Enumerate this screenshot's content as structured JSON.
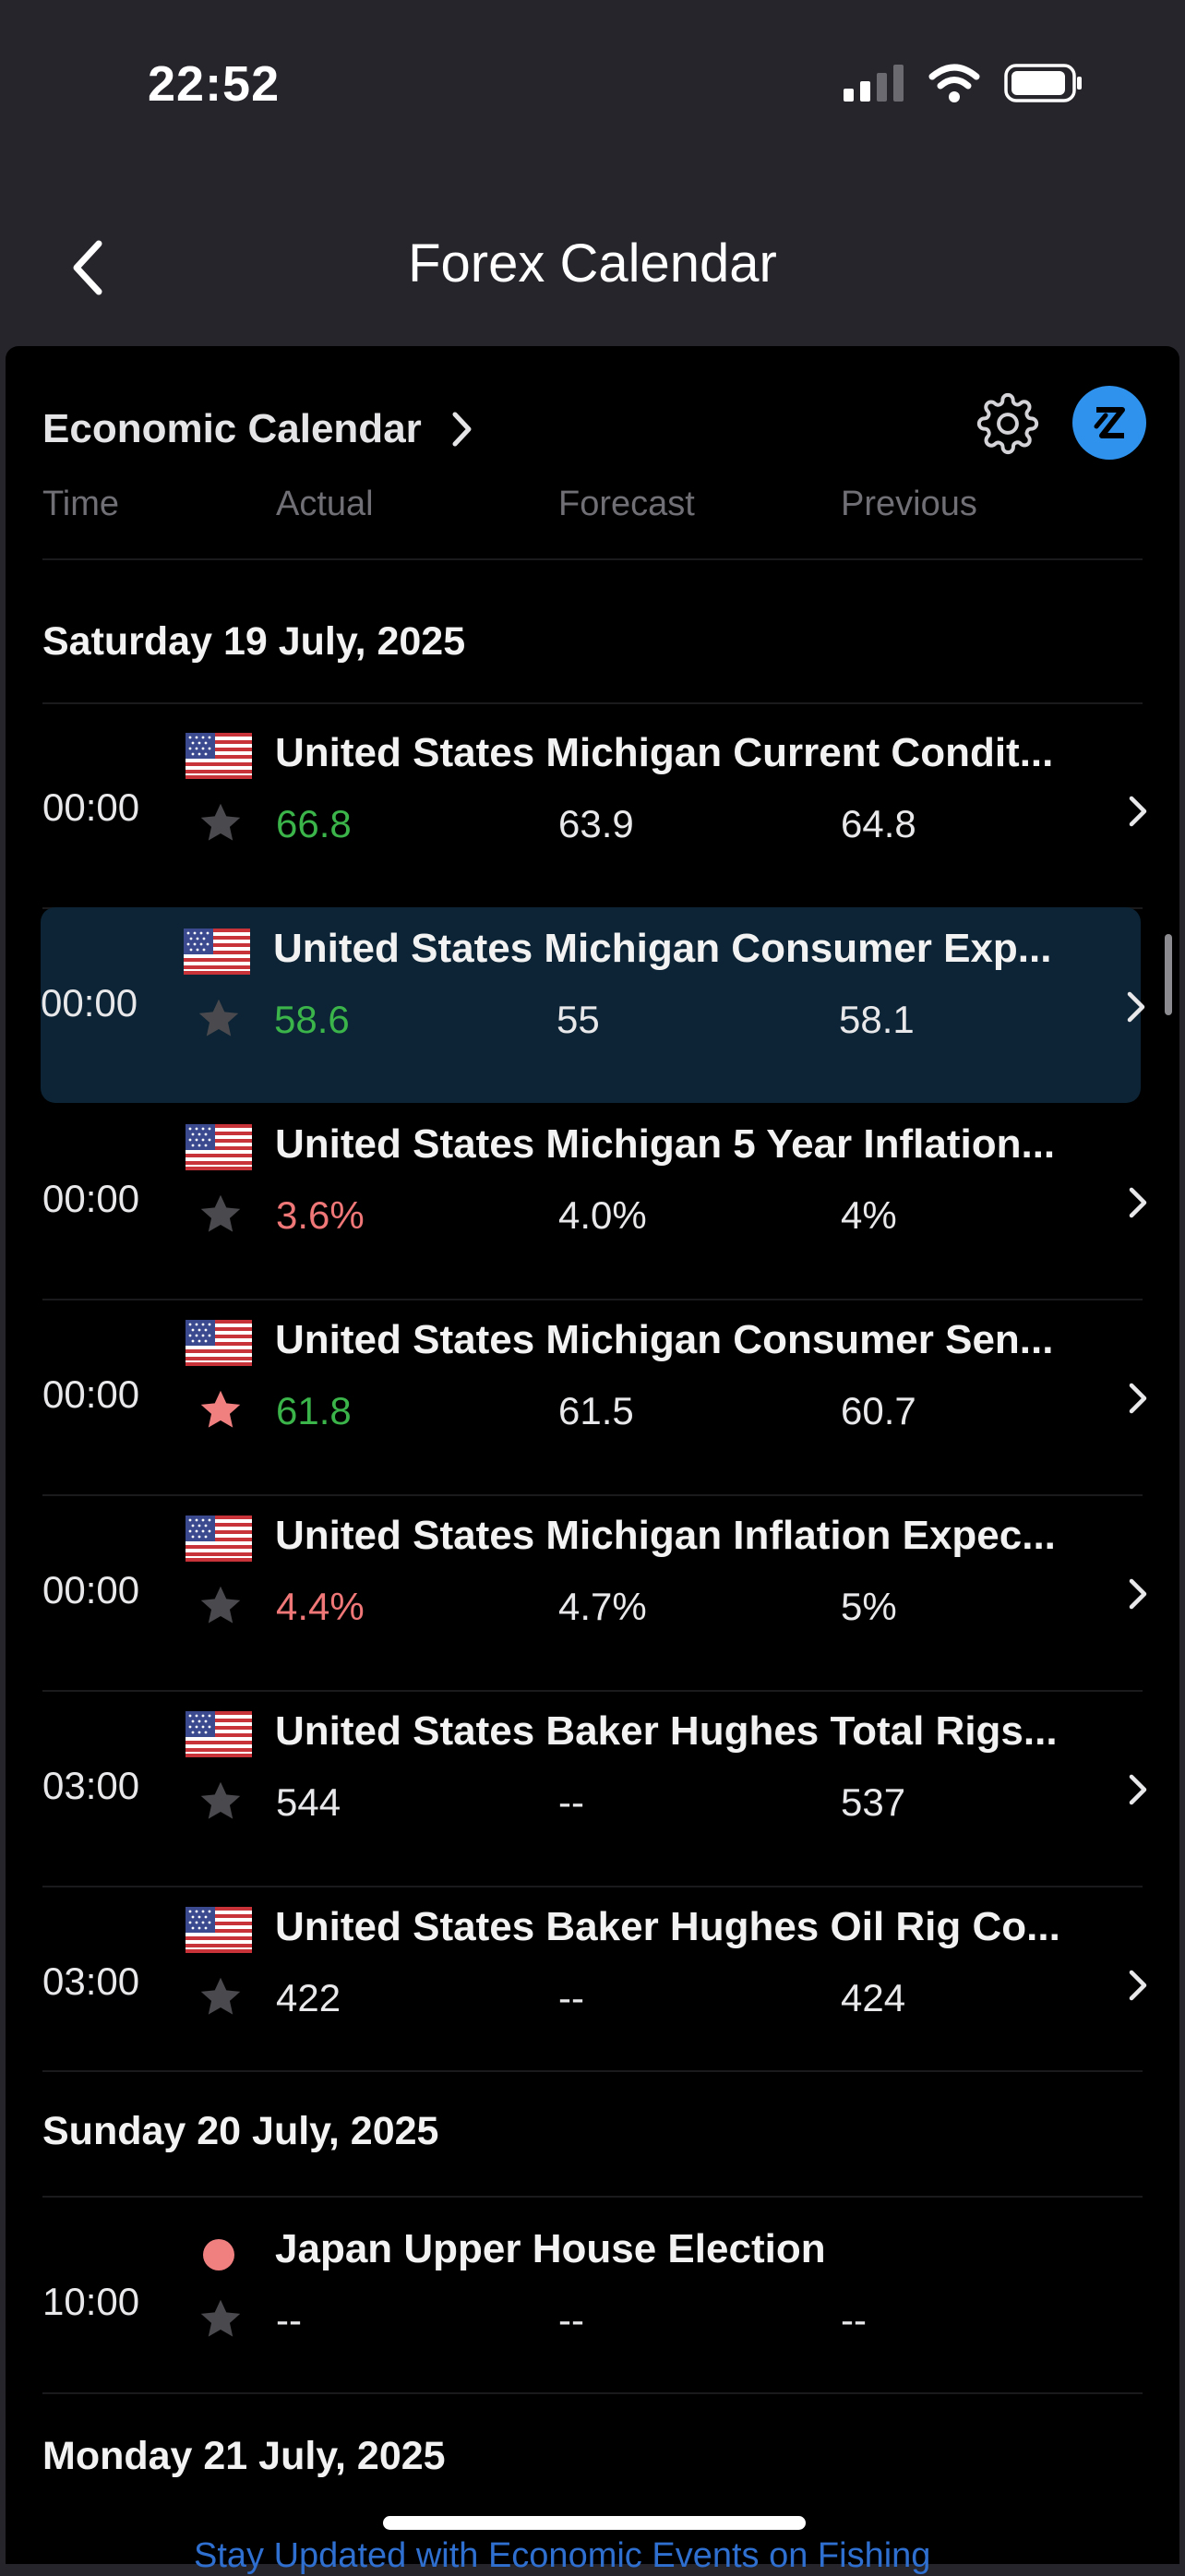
{
  "status_bar": {
    "time": "22:52"
  },
  "nav": {
    "title": "Forex Calendar"
  },
  "panel": {
    "title": "Economic Calendar",
    "columns": {
      "time": "Time",
      "actual": "Actual",
      "forecast": "Forecast",
      "previous": "Previous"
    }
  },
  "days": [
    {
      "label": "Saturday 19 July, 2025"
    },
    {
      "label": "Sunday 20 July, 2025"
    },
    {
      "label": "Monday 21 July, 2025"
    }
  ],
  "events": [
    {
      "time": "00:00",
      "name": "United States Michigan Current Condit...",
      "actual": "66.8",
      "forecast": "63.9",
      "previous": "64.8",
      "actual_trend": "up",
      "starred": false,
      "marker": "us-flag"
    },
    {
      "time": "00:00",
      "name": "United States Michigan Consumer Exp...",
      "actual": "58.6",
      "forecast": "55",
      "previous": "58.1",
      "actual_trend": "up",
      "starred": false,
      "marker": "us-flag",
      "highlighted": true
    },
    {
      "time": "00:00",
      "name": "United States Michigan 5 Year Inflation...",
      "actual": "3.6%",
      "forecast": "4.0%",
      "previous": "4%",
      "actual_trend": "down",
      "starred": false,
      "marker": "us-flag"
    },
    {
      "time": "00:00",
      "name": "United States Michigan Consumer Sen...",
      "actual": "61.8",
      "forecast": "61.5",
      "previous": "60.7",
      "actual_trend": "up",
      "starred": true,
      "marker": "us-flag"
    },
    {
      "time": "00:00",
      "name": "United States Michigan Inflation Expec...",
      "actual": "4.4%",
      "forecast": "4.7%",
      "previous": "5%",
      "actual_trend": "down",
      "starred": false,
      "marker": "us-flag"
    },
    {
      "time": "03:00",
      "name": "United States Baker Hughes Total Rigs...",
      "actual": "544",
      "forecast": "--",
      "previous": "537",
      "actual_trend": "neutral",
      "starred": false,
      "marker": "us-flag"
    },
    {
      "time": "03:00",
      "name": "United States Baker Hughes Oil Rig Co...",
      "actual": "422",
      "forecast": "--",
      "previous": "424",
      "actual_trend": "neutral",
      "starred": false,
      "marker": "us-flag"
    },
    {
      "time": "10:00",
      "name": "Japan Upper House Election",
      "actual": "--",
      "forecast": "--",
      "previous": "--",
      "actual_trend": "neutral",
      "starred": false,
      "marker": "japan-dot"
    }
  ],
  "promo": {
    "text": "Stay Updated with Economic Events on Fishing"
  },
  "colors": {
    "background": "#26252b",
    "panel": "#000000",
    "highlight_row": "#0c2435",
    "positive": "#3bb44a",
    "negative": "#f07777",
    "accent": "#2f93ee",
    "star_active": "#f07f80",
    "star_inactive": "#4a4a4e"
  },
  "icons": [
    "back-chevron-icon",
    "chevron-right-icon",
    "gear-icon",
    "brand-logo-icon",
    "star-icon",
    "us-flag-icon",
    "signal-icon",
    "wifi-icon",
    "battery-icon"
  ]
}
